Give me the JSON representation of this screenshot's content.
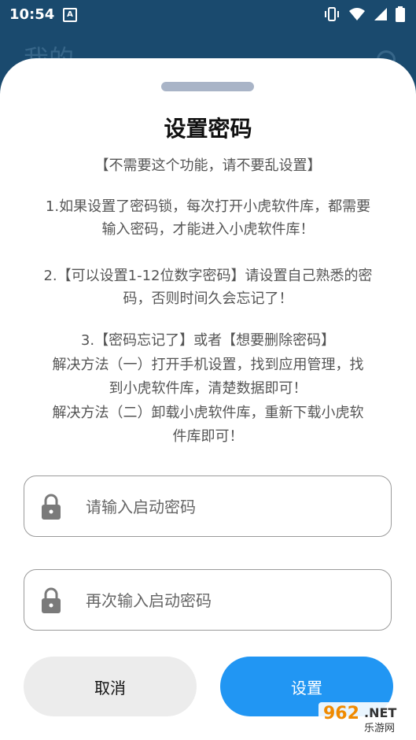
{
  "status_bar": {
    "time": "10:54",
    "notification_icon": "A"
  },
  "background": {
    "page_title": "我的"
  },
  "sheet": {
    "title": "设置密码",
    "subtitle": "【不需要这个功能，请不要乱设置】",
    "para1_line1": "1.如果设置了密码锁，每次打开小虎软件库，都需要",
    "para1_line2": "输入密码，才能进入小虎软件库！",
    "para2_line1": "2.【可以设置1-12位数字密码】请设置自己熟悉的密",
    "para2_line2": "码，否则时间久会忘记了！",
    "para3_line1": "3.【密码忘记了】或者【想要删除密码】",
    "para3_line2": "解决方法（一）打开手机设置，找到应用管理，找",
    "para3_line3": "到小虎软件库，清楚数据即可！",
    "para3_line4": "解决方法（二）卸载小虎软件库，重新下载小虎软",
    "para3_line5": "件库即可！",
    "password_field": {
      "placeholder": "请输入启动密码",
      "value": ""
    },
    "confirm_field": {
      "placeholder": "再次输入启动密码",
      "value": ""
    },
    "cancel_label": "取消",
    "set_label": "设置"
  },
  "watermark": {
    "logo": "962",
    "net": ".NET",
    "site": "乐游网"
  },
  "colors": {
    "accent": "#2196f3",
    "status_bar": "#1a4a6e",
    "cancel_bg": "#ececec"
  }
}
